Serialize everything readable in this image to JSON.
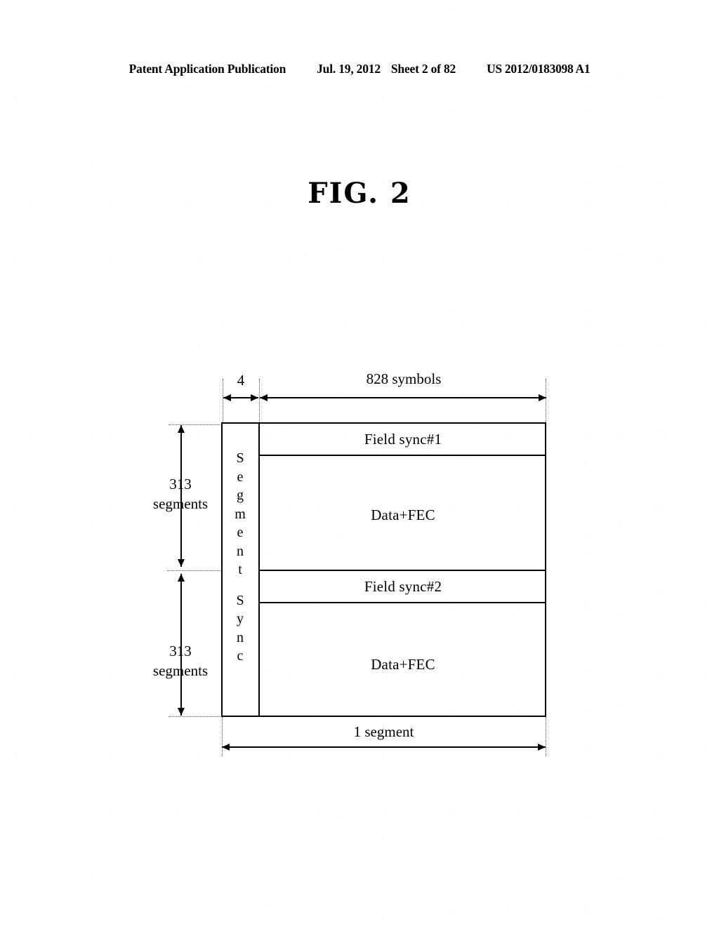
{
  "header": {
    "publication": "Patent Application Publication",
    "date": "Jul. 19, 2012",
    "sheet": "Sheet 2 of 82",
    "patent_number": "US 2012/0183098 A1"
  },
  "figure": {
    "title": "FIG. 2"
  },
  "chart_data": {
    "type": "diagram",
    "title": "FIG. 2",
    "description": "VSB frame structure showing segment sync column and field/data bands",
    "horizontal_dimensions": [
      {
        "label": "4",
        "span": "segment sync",
        "unit": "symbols"
      },
      {
        "label": "828 symbols",
        "span": "data",
        "unit": "symbols"
      },
      {
        "label": "1 segment",
        "span": "full frame width",
        "unit": "segment"
      }
    ],
    "vertical_dimensions": [
      {
        "number": "313",
        "unit": "segments",
        "position": "top"
      },
      {
        "number": "313",
        "unit": "segments",
        "position": "bottom"
      }
    ],
    "sync_column_label": "Segment Sync",
    "sync_column_letters": [
      "S",
      "e",
      "g",
      "m",
      "e",
      "n",
      "t",
      "",
      "S",
      "y",
      "n",
      "c"
    ],
    "bands": [
      {
        "label": "Field sync#1",
        "height_units": 1
      },
      {
        "label": "Data+FEC",
        "height_units": 3.5
      },
      {
        "label": "Field sync#2",
        "height_units": 1
      },
      {
        "label": "Data+FEC",
        "height_units": 3.5
      }
    ]
  },
  "labels": {
    "dim_4": "4",
    "dim_828": "828 symbols",
    "dim_1segment": "1 segment",
    "field_sync_1": "Field sync#1",
    "data_fec_1": "Data+FEC",
    "field_sync_2": "Field sync#2",
    "data_fec_2": "Data+FEC",
    "segments_count_top_num": "313",
    "segments_count_top_word": "segments",
    "segments_count_bottom_num": "313",
    "segments_count_bottom_word": "segments",
    "sync_letters": {
      "l0": "S",
      "l1": "e",
      "l2": "g",
      "l3": "m",
      "l4": "e",
      "l5": "n",
      "l6": "t",
      "l7": "S",
      "l8": "y",
      "l9": "n",
      "l10": "c"
    }
  }
}
